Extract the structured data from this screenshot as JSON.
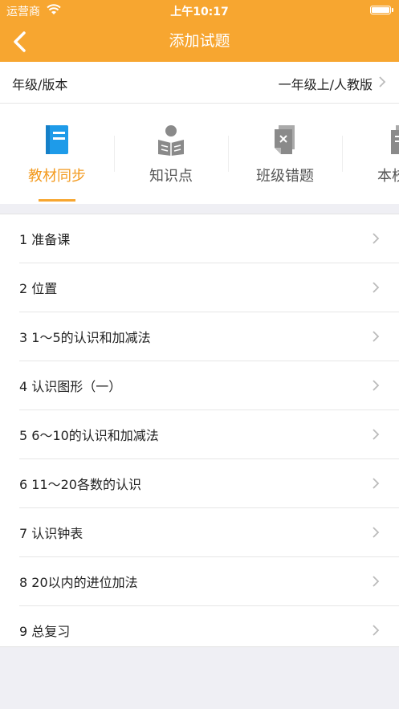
{
  "status_bar": {
    "carrier": "运营商",
    "time": "上午10:17"
  },
  "nav": {
    "title": "添加试题"
  },
  "grade": {
    "label": "年级/版本",
    "value": "一年级上/人教版"
  },
  "tabs": [
    {
      "label": "教材同步",
      "icon": "book-icon",
      "active": true
    },
    {
      "label": "知识点",
      "icon": "reader-icon",
      "active": false
    },
    {
      "label": "班级错题",
      "icon": "wrong-question-icon",
      "active": false
    },
    {
      "label": "本校作",
      "icon": "document-icon",
      "active": false
    }
  ],
  "chapters": [
    {
      "label": "1 准备课"
    },
    {
      "label": "2 位置"
    },
    {
      "label": "3 1～5的认识和加减法"
    },
    {
      "label": "4 认识图形（一）"
    },
    {
      "label": "5 6～10的认识和加减法"
    },
    {
      "label": "6 11～20各数的认识"
    },
    {
      "label": "7 认识钟表"
    },
    {
      "label": "8 20以内的进位加法"
    },
    {
      "label": "9 总复习"
    }
  ],
  "colors": {
    "accent": "#f7a630",
    "active_tab": "#f39a1e"
  }
}
